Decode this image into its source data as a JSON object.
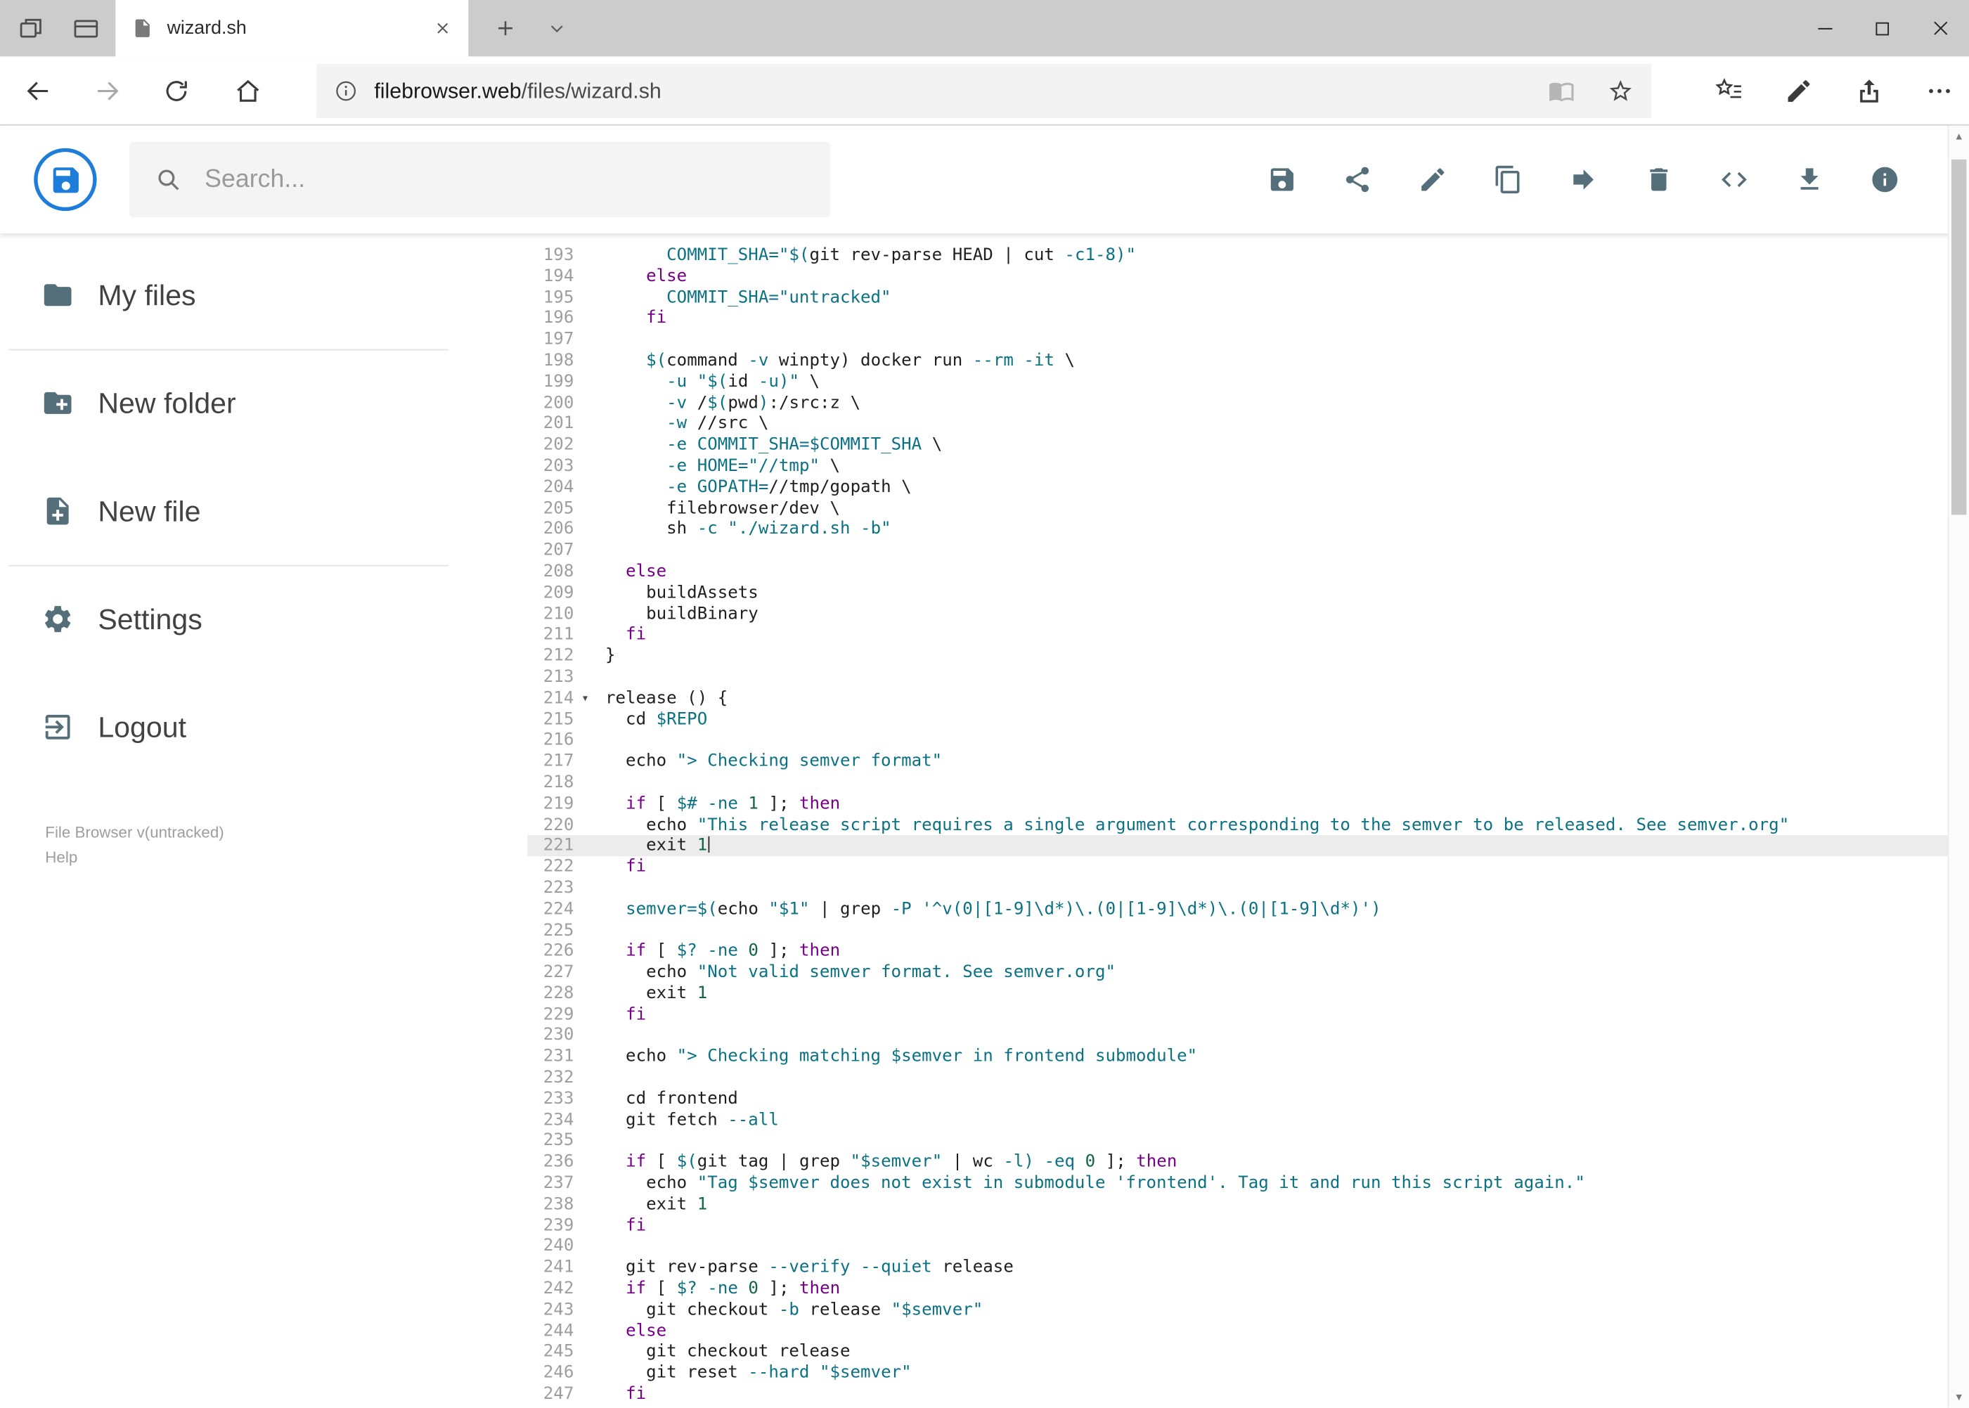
{
  "browser": {
    "tab_title": "wizard.sh",
    "url_domain": "filebrowser.web",
    "url_path": "/files/wizard.sh"
  },
  "header": {
    "search_placeholder": "Search...",
    "toolbar_icons": [
      "save",
      "share",
      "edit",
      "copy",
      "move",
      "delete",
      "code",
      "download",
      "info"
    ]
  },
  "sidebar": {
    "items": [
      {
        "label": "My files",
        "icon": "folder"
      },
      {
        "label": "New folder",
        "icon": "create-new-folder"
      },
      {
        "label": "New file",
        "icon": "note-add"
      },
      {
        "label": "Settings",
        "icon": "settings"
      },
      {
        "label": "Logout",
        "icon": "logout"
      }
    ],
    "footer_version": "File Browser v(untracked)",
    "footer_help": "Help"
  },
  "colors": {
    "logo_blue": "#1d7dd8",
    "icon_gray": "#546e7a",
    "keyword": "#770088",
    "string_teal": "#0b7285",
    "number_green": "#116644",
    "active_line_bg": "#ececec"
  },
  "editor": {
    "active_line": 221,
    "lines": [
      {
        "n": 193,
        "s": [
          [
            "p",
            "      "
          ],
          [
            "c",
            "COMMIT_SHA="
          ],
          [
            "c",
            "\"$("
          ],
          [
            "p",
            "git rev-parse HEAD | cut "
          ],
          [
            "c",
            "-c1-8"
          ],
          [
            "c",
            ")\""
          ]
        ]
      },
      {
        "n": 194,
        "s": [
          [
            "p",
            "    "
          ],
          [
            "k",
            "else"
          ]
        ]
      },
      {
        "n": 195,
        "s": [
          [
            "p",
            "      "
          ],
          [
            "c",
            "COMMIT_SHA="
          ],
          [
            "c",
            "\"untracked\""
          ]
        ]
      },
      {
        "n": 196,
        "s": [
          [
            "p",
            "    "
          ],
          [
            "k",
            "fi"
          ]
        ]
      },
      {
        "n": 197,
        "s": []
      },
      {
        "n": 198,
        "s": [
          [
            "p",
            "    "
          ],
          [
            "c",
            "$("
          ],
          [
            "p",
            "command "
          ],
          [
            "c",
            "-v"
          ],
          [
            "p",
            " winpty) docker run "
          ],
          [
            "c",
            "--rm"
          ],
          [
            "p",
            " "
          ],
          [
            "c",
            "-it"
          ],
          [
            "p",
            " \\"
          ]
        ]
      },
      {
        "n": 199,
        "s": [
          [
            "p",
            "      "
          ],
          [
            "c",
            "-u"
          ],
          [
            "p",
            " "
          ],
          [
            "c",
            "\"$("
          ],
          [
            "p",
            "id "
          ],
          [
            "c",
            "-u"
          ],
          [
            "c",
            ")\""
          ],
          [
            "p",
            " \\"
          ]
        ]
      },
      {
        "n": 200,
        "s": [
          [
            "p",
            "      "
          ],
          [
            "c",
            "-v"
          ],
          [
            "p",
            " /"
          ],
          [
            "c",
            "$("
          ],
          [
            "p",
            "pwd"
          ],
          [
            "c",
            ")"
          ],
          [
            "p",
            ":/src:z \\"
          ]
        ]
      },
      {
        "n": 201,
        "s": [
          [
            "p",
            "      "
          ],
          [
            "c",
            "-w"
          ],
          [
            "p",
            " //src \\"
          ]
        ]
      },
      {
        "n": 202,
        "s": [
          [
            "p",
            "      "
          ],
          [
            "c",
            "-e"
          ],
          [
            "p",
            " "
          ],
          [
            "c",
            "COMMIT_SHA="
          ],
          [
            "c",
            "$COMMIT_SHA"
          ],
          [
            "p",
            " \\"
          ]
        ]
      },
      {
        "n": 203,
        "s": [
          [
            "p",
            "      "
          ],
          [
            "c",
            "-e"
          ],
          [
            "p",
            " "
          ],
          [
            "c",
            "HOME="
          ],
          [
            "c",
            "\"//tmp\""
          ],
          [
            "p",
            " \\"
          ]
        ]
      },
      {
        "n": 204,
        "s": [
          [
            "p",
            "      "
          ],
          [
            "c",
            "-e"
          ],
          [
            "p",
            " "
          ],
          [
            "c",
            "GOPATH="
          ],
          [
            "p",
            "//tmp/gopath \\"
          ]
        ]
      },
      {
        "n": 205,
        "s": [
          [
            "p",
            "      filebrowser/dev \\"
          ]
        ]
      },
      {
        "n": 206,
        "s": [
          [
            "p",
            "      sh "
          ],
          [
            "c",
            "-c"
          ],
          [
            "p",
            " "
          ],
          [
            "c",
            "\"./wizard.sh -b\""
          ]
        ]
      },
      {
        "n": 207,
        "s": []
      },
      {
        "n": 208,
        "s": [
          [
            "p",
            "  "
          ],
          [
            "k",
            "else"
          ]
        ]
      },
      {
        "n": 209,
        "s": [
          [
            "p",
            "    buildAssets"
          ]
        ]
      },
      {
        "n": 210,
        "s": [
          [
            "p",
            "    buildBinary"
          ]
        ]
      },
      {
        "n": 211,
        "s": [
          [
            "p",
            "  "
          ],
          [
            "k",
            "fi"
          ]
        ]
      },
      {
        "n": 212,
        "s": [
          [
            "p",
            "}"
          ]
        ]
      },
      {
        "n": 213,
        "s": []
      },
      {
        "n": 214,
        "f": true,
        "s": [
          [
            "p",
            "release () {"
          ]
        ]
      },
      {
        "n": 215,
        "s": [
          [
            "p",
            "  cd "
          ],
          [
            "c",
            "$REPO"
          ]
        ]
      },
      {
        "n": 216,
        "s": []
      },
      {
        "n": 217,
        "s": [
          [
            "p",
            "  echo "
          ],
          [
            "c",
            "\"> Checking semver format\""
          ]
        ]
      },
      {
        "n": 218,
        "s": []
      },
      {
        "n": 219,
        "s": [
          [
            "p",
            "  "
          ],
          [
            "k",
            "if"
          ],
          [
            "p",
            " [ "
          ],
          [
            "c",
            "$#"
          ],
          [
            "p",
            " "
          ],
          [
            "c",
            "-ne"
          ],
          [
            "p",
            " "
          ],
          [
            "d",
            "1"
          ],
          [
            "p",
            " ]; "
          ],
          [
            "k",
            "then"
          ]
        ]
      },
      {
        "n": 220,
        "s": [
          [
            "p",
            "    echo "
          ],
          [
            "c",
            "\"This release script requires a single argument corresponding to the semver to be released. See semver.org\""
          ]
        ]
      },
      {
        "n": 221,
        "a": true,
        "cur": true,
        "s": [
          [
            "p",
            "    exit "
          ],
          [
            "d",
            "1"
          ]
        ]
      },
      {
        "n": 222,
        "s": [
          [
            "p",
            "  "
          ],
          [
            "k",
            "fi"
          ]
        ]
      },
      {
        "n": 223,
        "s": []
      },
      {
        "n": 224,
        "s": [
          [
            "p",
            "  "
          ],
          [
            "c",
            "semver="
          ],
          [
            "c",
            "$("
          ],
          [
            "p",
            "echo "
          ],
          [
            "c",
            "\"$1\""
          ],
          [
            "p",
            " | grep "
          ],
          [
            "c",
            "-P"
          ],
          [
            "p",
            " "
          ],
          [
            "c",
            "'^v(0|[1-9]\\d*)\\.(0|[1-9]\\d*)\\.(0|[1-9]\\d*)'"
          ],
          [
            "c",
            ")"
          ]
        ]
      },
      {
        "n": 225,
        "s": []
      },
      {
        "n": 226,
        "s": [
          [
            "p",
            "  "
          ],
          [
            "k",
            "if"
          ],
          [
            "p",
            " [ "
          ],
          [
            "c",
            "$?"
          ],
          [
            "p",
            " "
          ],
          [
            "c",
            "-ne"
          ],
          [
            "p",
            " "
          ],
          [
            "d",
            "0"
          ],
          [
            "p",
            " ]; "
          ],
          [
            "k",
            "then"
          ]
        ]
      },
      {
        "n": 227,
        "s": [
          [
            "p",
            "    echo "
          ],
          [
            "c",
            "\"Not valid semver format. See semver.org\""
          ]
        ]
      },
      {
        "n": 228,
        "s": [
          [
            "p",
            "    exit "
          ],
          [
            "d",
            "1"
          ]
        ]
      },
      {
        "n": 229,
        "s": [
          [
            "p",
            "  "
          ],
          [
            "k",
            "fi"
          ]
        ]
      },
      {
        "n": 230,
        "s": []
      },
      {
        "n": 231,
        "s": [
          [
            "p",
            "  echo "
          ],
          [
            "c",
            "\"> Checking matching $semver in frontend submodule\""
          ]
        ]
      },
      {
        "n": 232,
        "s": []
      },
      {
        "n": 233,
        "s": [
          [
            "p",
            "  cd frontend"
          ]
        ]
      },
      {
        "n": 234,
        "s": [
          [
            "p",
            "  git fetch "
          ],
          [
            "c",
            "--all"
          ]
        ]
      },
      {
        "n": 235,
        "s": []
      },
      {
        "n": 236,
        "s": [
          [
            "p",
            "  "
          ],
          [
            "k",
            "if"
          ],
          [
            "p",
            " [ "
          ],
          [
            "c",
            "$("
          ],
          [
            "p",
            "git tag | grep "
          ],
          [
            "c",
            "\"$semver\""
          ],
          [
            "p",
            " | wc "
          ],
          [
            "c",
            "-l"
          ],
          [
            "c",
            ")"
          ],
          [
            "p",
            " "
          ],
          [
            "c",
            "-eq"
          ],
          [
            "p",
            " "
          ],
          [
            "d",
            "0"
          ],
          [
            "p",
            " ]; "
          ],
          [
            "k",
            "then"
          ]
        ]
      },
      {
        "n": 237,
        "s": [
          [
            "p",
            "    echo "
          ],
          [
            "c",
            "\"Tag $semver does not exist in submodule 'frontend'. Tag it and run this script again.\""
          ]
        ]
      },
      {
        "n": 238,
        "s": [
          [
            "p",
            "    exit "
          ],
          [
            "d",
            "1"
          ]
        ]
      },
      {
        "n": 239,
        "s": [
          [
            "p",
            "  "
          ],
          [
            "k",
            "fi"
          ]
        ]
      },
      {
        "n": 240,
        "s": []
      },
      {
        "n": 241,
        "s": [
          [
            "p",
            "  git rev-parse "
          ],
          [
            "c",
            "--verify"
          ],
          [
            "p",
            " "
          ],
          [
            "c",
            "--quiet"
          ],
          [
            "p",
            " release"
          ]
        ]
      },
      {
        "n": 242,
        "s": [
          [
            "p",
            "  "
          ],
          [
            "k",
            "if"
          ],
          [
            "p",
            " [ "
          ],
          [
            "c",
            "$?"
          ],
          [
            "p",
            " "
          ],
          [
            "c",
            "-ne"
          ],
          [
            "p",
            " "
          ],
          [
            "d",
            "0"
          ],
          [
            "p",
            " ]; "
          ],
          [
            "k",
            "then"
          ]
        ]
      },
      {
        "n": 243,
        "s": [
          [
            "p",
            "    git checkout "
          ],
          [
            "c",
            "-b"
          ],
          [
            "p",
            " release "
          ],
          [
            "c",
            "\"$semver\""
          ]
        ]
      },
      {
        "n": 244,
        "s": [
          [
            "p",
            "  "
          ],
          [
            "k",
            "else"
          ]
        ]
      },
      {
        "n": 245,
        "s": [
          [
            "p",
            "    git checkout release"
          ]
        ]
      },
      {
        "n": 246,
        "s": [
          [
            "p",
            "    git reset "
          ],
          [
            "c",
            "--hard"
          ],
          [
            "p",
            " "
          ],
          [
            "c",
            "\"$semver\""
          ]
        ]
      },
      {
        "n": 247,
        "s": [
          [
            "p",
            "  "
          ],
          [
            "k",
            "fi"
          ]
        ]
      }
    ]
  }
}
